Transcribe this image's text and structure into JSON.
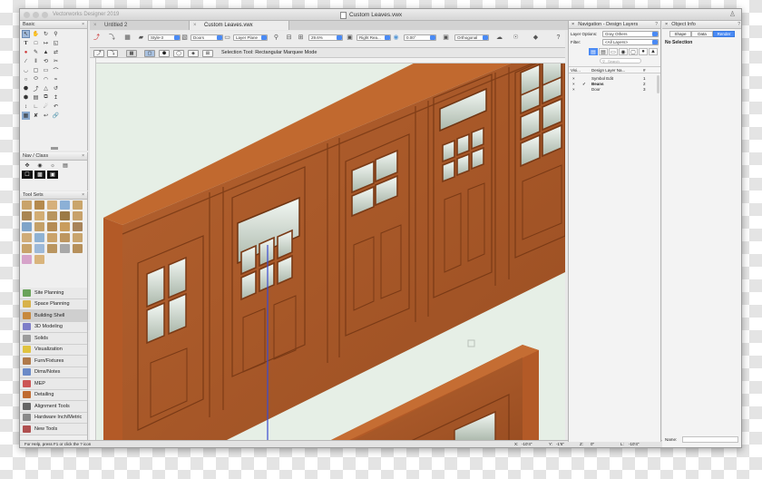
{
  "app": {
    "name": "Vectorworks Designer 2019",
    "document_title": "Custom Leaves.vwx"
  },
  "tabs": [
    {
      "label": "Untitled 2",
      "active": false
    },
    {
      "label": "Custom Leaves.vwx",
      "active": true
    }
  ],
  "palettes": {
    "basic": {
      "title": "Basic"
    },
    "nav_class": {
      "title": "Nav / Class"
    },
    "tool_sets": {
      "title": "Tool Sets",
      "items": [
        {
          "label": "Site Planning",
          "icon": "site-planning-icon",
          "color": "#6aa35a"
        },
        {
          "label": "Space Planning",
          "icon": "space-planning-icon",
          "color": "#d8b24a"
        },
        {
          "label": "Building Shell",
          "icon": "building-shell-icon",
          "color": "#c7893c",
          "active": true
        },
        {
          "label": "3D Modeling",
          "icon": "3d-modeling-icon",
          "color": "#7d7dc8"
        },
        {
          "label": "Solids",
          "icon": "solids-icon",
          "color": "#9c9c9c"
        },
        {
          "label": "Visualization",
          "icon": "visualization-icon",
          "color": "#e0c340"
        },
        {
          "label": "Furn/Fixtures",
          "icon": "furniture-icon",
          "color": "#b07a4a"
        },
        {
          "label": "Dims/Notes",
          "icon": "dims-notes-icon",
          "color": "#6a8ac7"
        },
        {
          "label": "MEP",
          "icon": "mep-icon",
          "color": "#cc5555"
        },
        {
          "label": "Detailing",
          "icon": "detailing-icon",
          "color": "#bf6a30"
        },
        {
          "label": "Alignment Tools",
          "icon": "alignment-icon",
          "color": "#666666"
        },
        {
          "label": "Hardware Inch/Metric",
          "icon": "hardware-icon",
          "color": "#8a8a8a"
        },
        {
          "label": "New Tools",
          "icon": "new-tools-icon",
          "color": "#b05050"
        }
      ]
    }
  },
  "toolbar": {
    "style": "Style-3",
    "class": "Doors",
    "layer": "Layer Plane",
    "zoom": "29.6%",
    "view": "Right Rea...",
    "angle": "0.00°",
    "projection": "Orthogonal"
  },
  "mode_bar": {
    "text": "Selection Tool: Rectangular Marquee Mode"
  },
  "status_bar": {
    "hint": "For Help, press F1 or click the ? icon",
    "x_label": "X:",
    "x_value": "-10'4\"",
    "y_label": "Y:",
    "y_value": "-1'6\"",
    "z_label": "Z:",
    "z_value": "0\"",
    "l_label": "L:",
    "l_value": "-10'4\"",
    "a_label": "A:",
    "a_value": "-1'6\""
  },
  "navigation": {
    "title": "Navigation - Design Layers",
    "layer_options_label": "Layer Options:",
    "layer_options_value": "Gray Others",
    "filter_label": "Filter:",
    "filter_value": "<All Layers>",
    "search_placeholder": "Search",
    "columns": {
      "visibility": "Visi...",
      "name": "Design Layer Na...",
      "number": "#"
    },
    "layers": [
      {
        "name": "Symbol Edit",
        "number": "1",
        "active": false
      },
      {
        "name": "Beans",
        "number": "2",
        "active": true
      },
      {
        "name": "Door",
        "number": "3",
        "active": false
      }
    ]
  },
  "object_info": {
    "title": "Object Info",
    "tabs": [
      "Shape",
      "Data",
      "Render"
    ],
    "active_tab": "Render",
    "selection": "No Selection",
    "name_label": "Name:"
  }
}
